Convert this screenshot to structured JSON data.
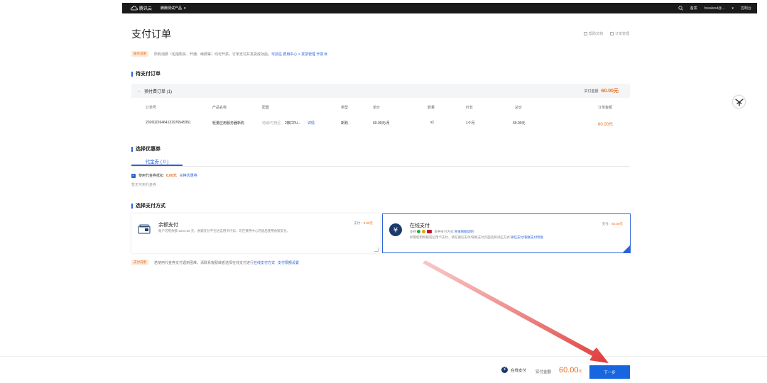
{
  "topbar": {
    "logo_text": "腾讯云",
    "product_label": "腾腾测试产品",
    "caret": "▾",
    "right_items": [
      "备案",
      "breakout@...",
      "▾",
      "控制台"
    ]
  },
  "header": {
    "title": "支付订单",
    "links": [
      "帮助文档",
      "订单管理"
    ]
  },
  "notice": {
    "tag": "服务说明",
    "text": "所有消费（包括购买、开通、续费等）均可开票。订单支付并发货成功后，",
    "link": "可前往 费用中心 > 发票管理 开票 ⧉"
  },
  "pending": {
    "section_title": "待支付订单",
    "group_label": "预付费订单 (1)",
    "pay_label": "实付金额",
    "pay_amount": "60.00元",
    "columns": [
      "订单号",
      "产品名称",
      "配置",
      "类型",
      "单价",
      "数量",
      "时长",
      "总价",
      "订单金额"
    ],
    "row": {
      "order_no": "20260226464131976545351",
      "product": "轻量应用服务器新购",
      "config_muted": "地域/可用区",
      "config": "2核CPU...",
      "detail_link": "详情",
      "type": "新购",
      "unit_price": "60.00元/月",
      "qty": "x1",
      "duration": "1个月",
      "total": "60.00元",
      "amount": "60.00元"
    }
  },
  "coupon": {
    "section_title": "选择优惠券",
    "tab": "代金券 ( 0 )",
    "check_label": "使用代金券抵扣",
    "check_amount": "0.00元",
    "check_link": "兑换优惠券",
    "empty": "暂无可用代金券"
  },
  "payment": {
    "section_title": "选择支付方式",
    "balance": {
      "title": "余额支付",
      "desc": "账户可用余额 1234.56 元，余额支付不包括信用卡代扣，可在费用中心充值后使用余额支付。",
      "pay": "支付：",
      "pay_amount": "0.00元"
    },
    "online": {
      "title": "在线支付",
      "desc_prefix": "支持",
      "desc_mid": "多种支付方式",
      "desc_link": "充值限额说明",
      "desc2": "如需使用网银或信用卡支付，请在微信支付/银联支付页面选择对应方式",
      "desc2_link": "微信支付/银联支付帮助",
      "pay": "支付：",
      "pay_amount": "60.00元"
    },
    "notice_tag": "支付说明",
    "notice_text": "若使用代金券支付遇到困难，请联系客服或者选择在线支付进行",
    "notice_link1": "在线支付方式",
    "notice_link2": "支付限额设置"
  },
  "bottombar": {
    "method_icon": "¥",
    "method": "在线支付",
    "label": "实付金额",
    "amount": "60.00",
    "unit": "元",
    "next": "下一步"
  },
  "colors": {
    "accent": "#2a62d8",
    "button": "#1766e0",
    "amount": "#e66d1c",
    "arrow": "#e03a3a"
  },
  "icons": [
    "cloud-logo-icon",
    "search-icon",
    "chevron-down-icon",
    "help-doc-icon",
    "order-icon",
    "wallet-icon",
    "yuan-icon",
    "assistant-icon",
    "red-arrow"
  ]
}
